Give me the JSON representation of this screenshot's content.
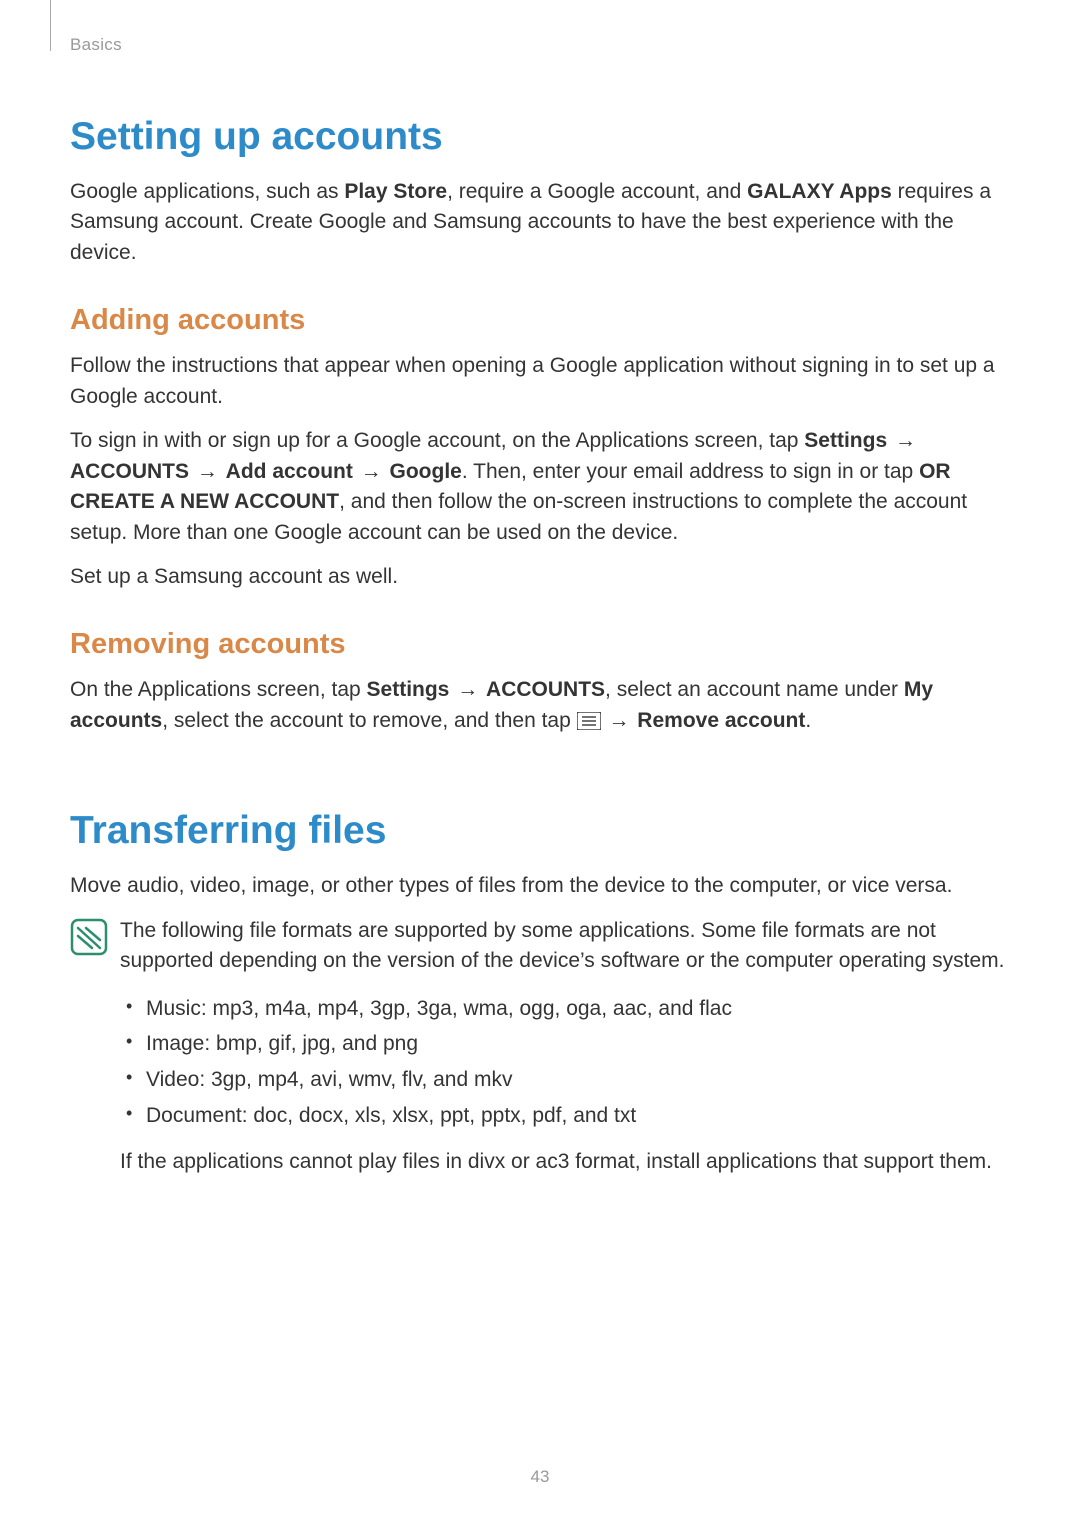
{
  "header": {
    "breadcrumb": "Basics"
  },
  "section1": {
    "title": "Setting up accounts",
    "intro": {
      "p1a": "Google applications, such as ",
      "p1b": "Play Store",
      "p1c": ", require a Google account, and ",
      "p1d": "GALAXY Apps",
      "p1e": " requires a Samsung account. Create Google and Samsung accounts to have the best experience with the device."
    },
    "add": {
      "heading": "Adding accounts",
      "p1": "Follow the instructions that appear when opening a Google application without signing in to set up a Google account.",
      "p2": {
        "a": "To sign in with or sign up for a Google account, on the Applications screen, tap ",
        "settings": "Settings",
        "arrow1": " → ",
        "accounts": "ACCOUNTS",
        "arrow2": " → ",
        "addacct": "Add account",
        "arrow3": " → ",
        "google": "Google",
        "b": ". Then, enter your email address to sign in or tap ",
        "create": "OR CREATE A NEW ACCOUNT",
        "c": ", and then follow the on-screen instructions to complete the account setup. More than one Google account can be used on the device."
      },
      "p3": "Set up a Samsung account as well."
    },
    "remove": {
      "heading": "Removing accounts",
      "p1": {
        "a": "On the Applications screen, tap ",
        "settings": "Settings",
        "arrow1": " → ",
        "accounts": "ACCOUNTS",
        "b": ", select an account name under ",
        "myaccts": "My accounts",
        "c": ", select the account to remove, and then tap ",
        "arrow2": " → ",
        "removeacct": "Remove account",
        "d": "."
      }
    }
  },
  "section2": {
    "title": "Transferring files",
    "intro": "Move audio, video, image, or other types of files from the device to the computer, or vice versa.",
    "note": {
      "p1": "The following file formats are supported by some applications. Some file formats are not supported depending on the version of the device’s software or the computer operating system.",
      "bullets": [
        "Music: mp3, m4a, mp4, 3gp, 3ga, wma, ogg, oga, aac, and flac",
        "Image: bmp, gif, jpg, and png",
        "Video: 3gp, mp4, avi, wmv, flv, and mkv",
        "Document: doc, docx, xls, xlsx, ppt, pptx, pdf, and txt"
      ],
      "p2": "If the applications cannot play files in divx or ac3 format, install applications that support them."
    }
  },
  "page_number": "43"
}
